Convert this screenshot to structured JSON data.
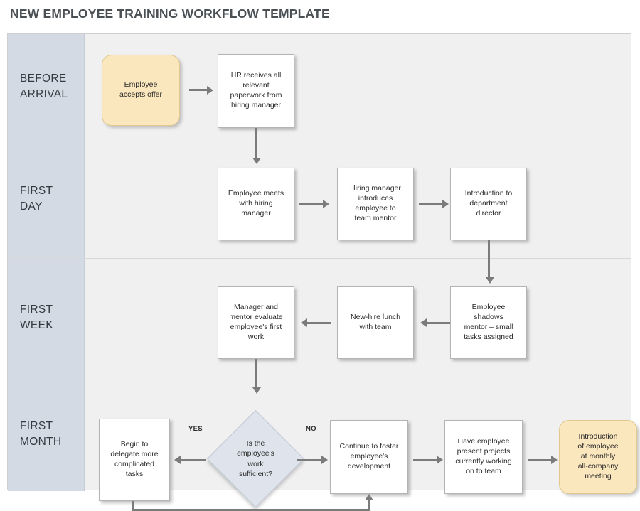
{
  "page": {
    "title": "NEW EMPLOYEE TRAINING WORKFLOW TEMPLATE"
  },
  "colors": {
    "title_text": "#4b5054",
    "lane_header_bg": "#d3dae3",
    "canvas_bg": "#f0f0f0",
    "terminator_fill": "#fbe7bd",
    "decision_fill": "#dfe4ec",
    "process_fill": "#ffffff",
    "connector": "#7b7b7b"
  },
  "lanes": [
    {
      "id": "before-arrival",
      "label": "BEFORE\nARRIVAL",
      "nodes": [
        {
          "id": "employee-accepts-offer",
          "type": "terminator",
          "text": "Employee\naccepts offer"
        },
        {
          "id": "hr-receives-paperwork",
          "type": "process",
          "text": "HR receives all\nrelevant\npaperwork from\nhiring manager"
        }
      ]
    },
    {
      "id": "first-day",
      "label": "FIRST\nDAY",
      "nodes": [
        {
          "id": "employee-meets-hiring-manager",
          "type": "process",
          "text": "Employee meets\nwith hiring\nmanager"
        },
        {
          "id": "hiring-manager-introduces-mentor",
          "type": "process",
          "text": "Hiring manager\nintroduces\nemployee to\nteam mentor"
        },
        {
          "id": "introduction-to-department-director",
          "type": "process",
          "text": "Introduction to\ndepartment\ndirector"
        }
      ]
    },
    {
      "id": "first-week",
      "label": "FIRST\nWEEK",
      "nodes": [
        {
          "id": "manager-mentor-evaluate",
          "type": "process",
          "text": "Manager and\nmentor evaluate\nemployee's first\nwork"
        },
        {
          "id": "new-hire-lunch",
          "type": "process",
          "text": "New-hire lunch\nwith team"
        },
        {
          "id": "employee-shadows-mentor",
          "type": "process",
          "text": "Employee\nshadows\nmentor – small\ntasks assigned"
        }
      ]
    },
    {
      "id": "first-month",
      "label": "FIRST\nMONTH",
      "nodes": [
        {
          "id": "begin-to-delegate",
          "type": "process",
          "text": "Begin to\ndelegate more\ncomplicated\ntasks"
        },
        {
          "id": "work-sufficient-decision",
          "type": "decision",
          "text": "Is the\nemployee's\nwork\nsufficient?"
        },
        {
          "id": "continue-to-foster",
          "type": "process",
          "text": "Continue to foster\nemployee's\ndevelopment"
        },
        {
          "id": "have-employee-present",
          "type": "process",
          "text": "Have employee\npresent projects\ncurrently working\non to team"
        },
        {
          "id": "introduction-at-monthly-meeting",
          "type": "terminator",
          "text": "Introduction\nof employee\nat monthly\nall-company\nmeeting"
        }
      ]
    }
  ],
  "edge_labels": {
    "yes": "YES",
    "no": "NO"
  }
}
